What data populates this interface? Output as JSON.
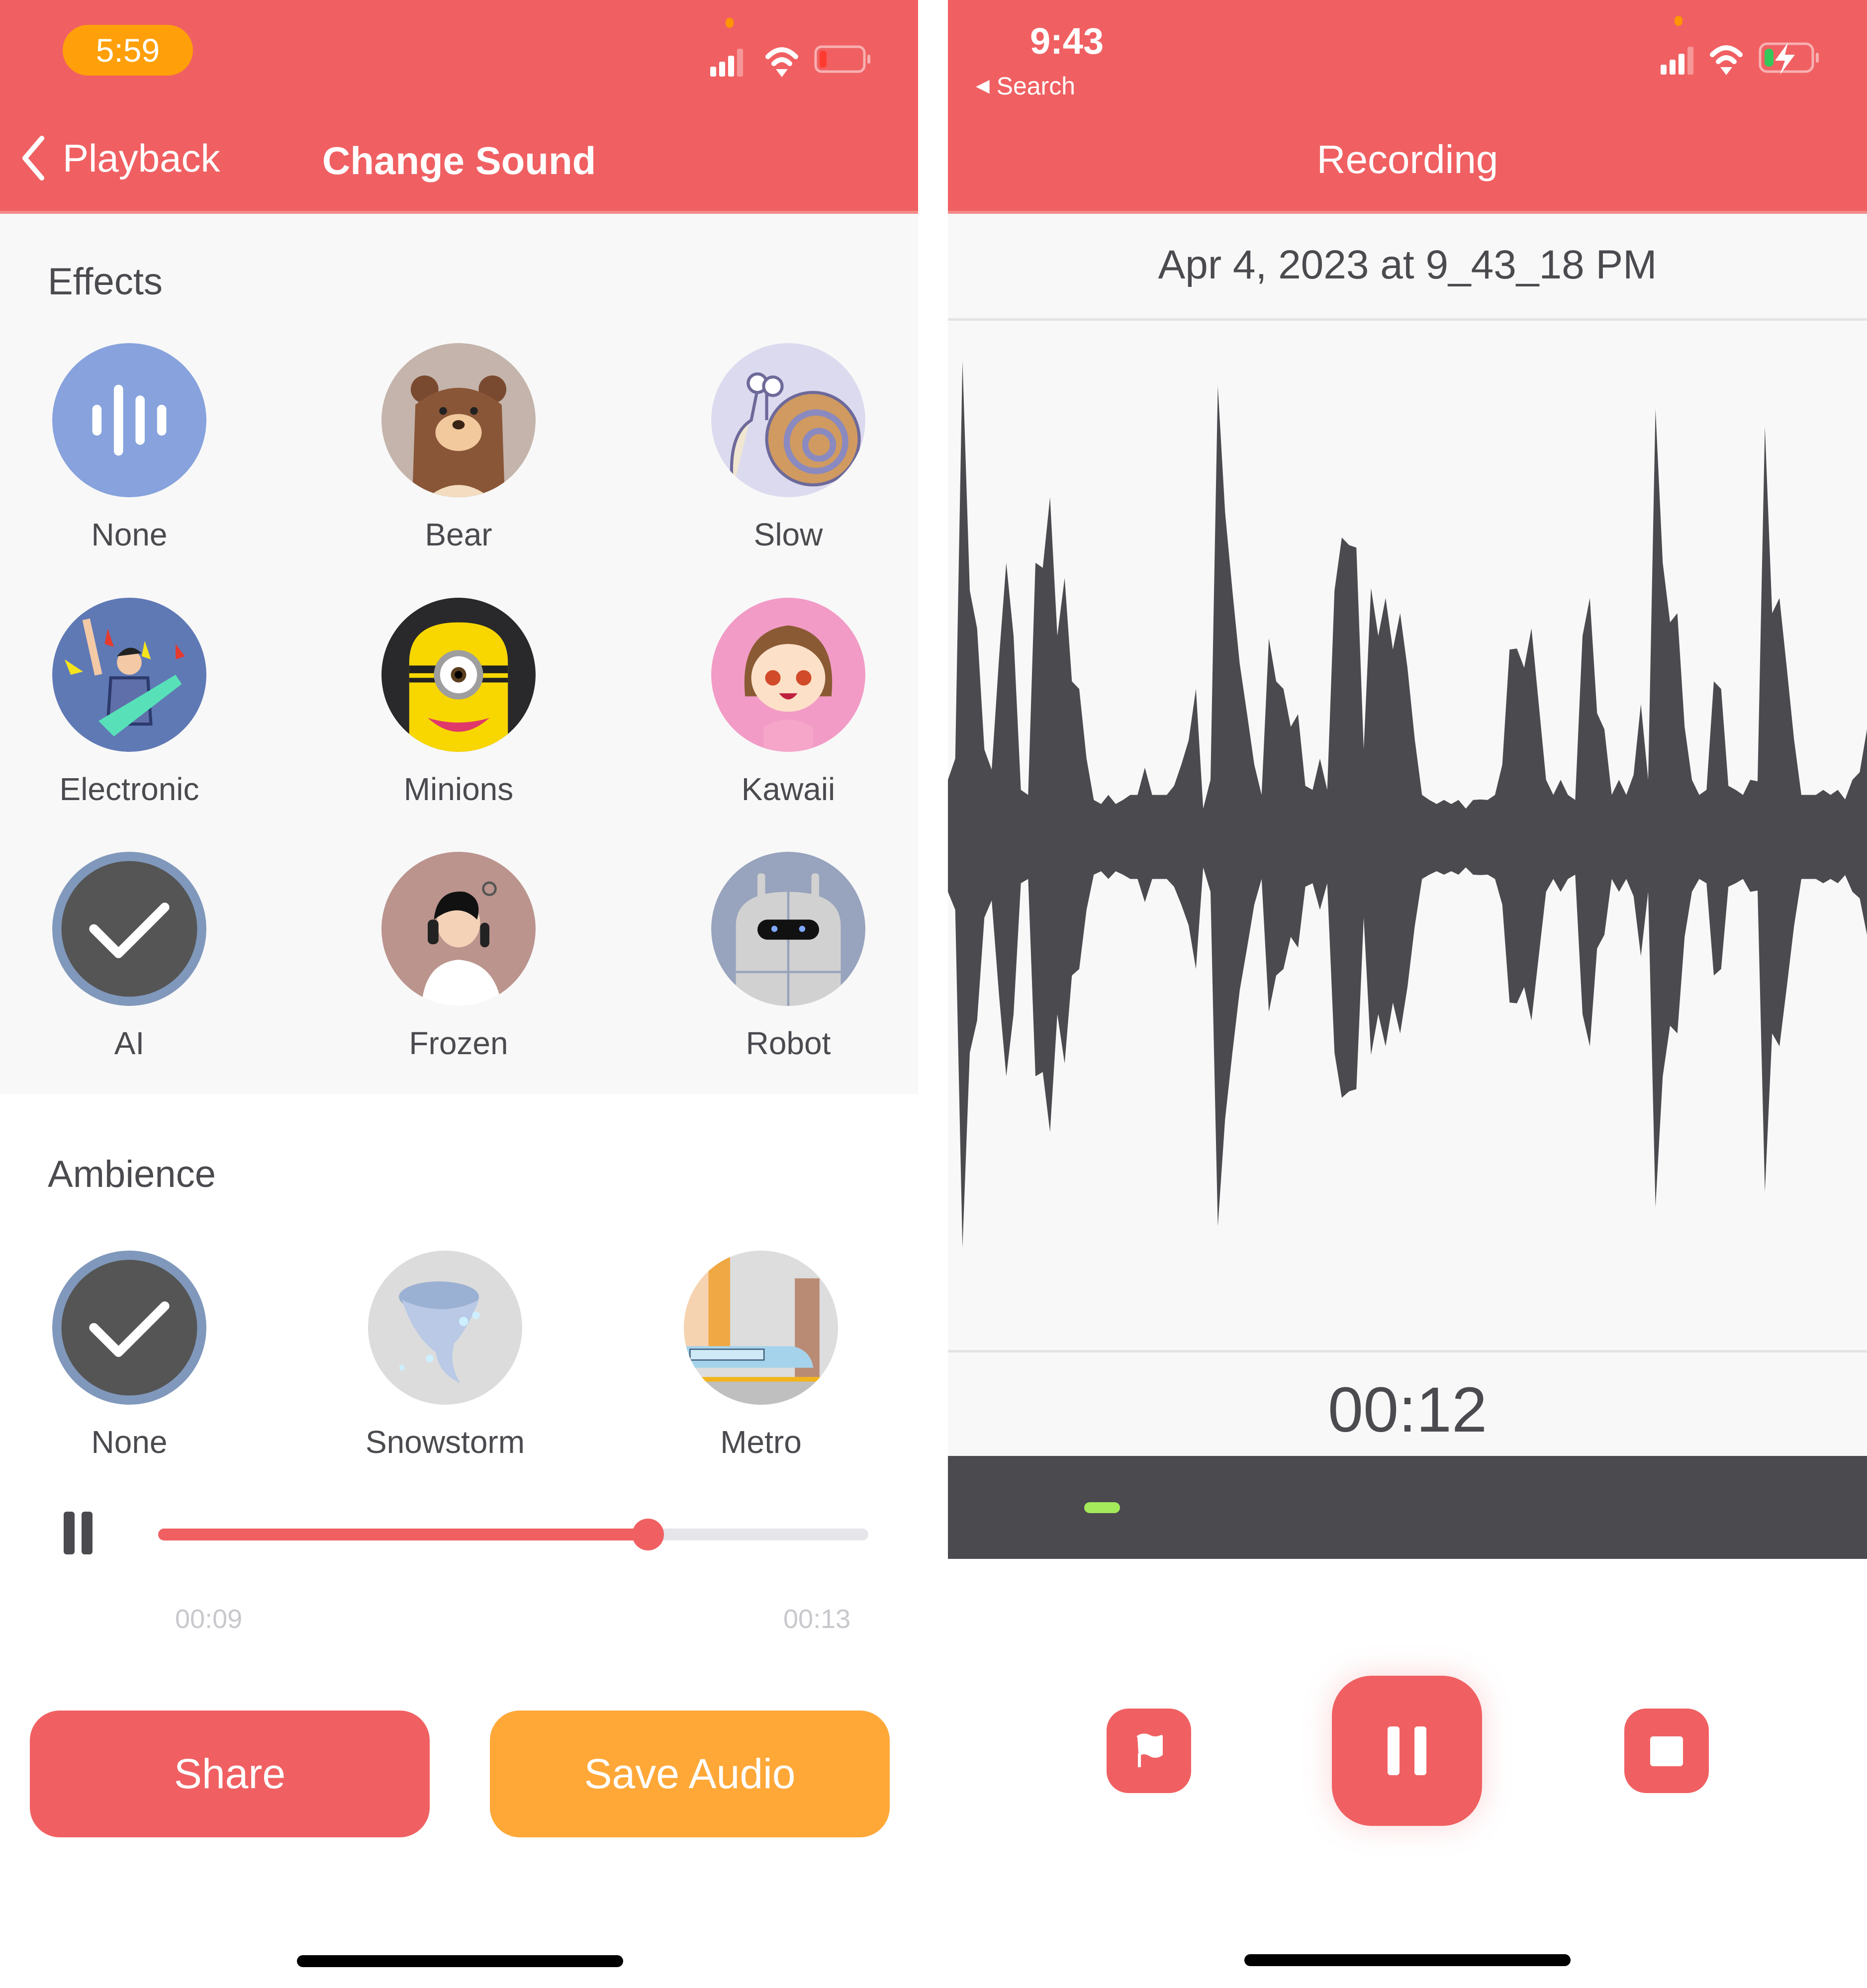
{
  "left_screen": {
    "status_bar": {
      "time": "5:59",
      "battery_level": "low",
      "battery_color": "#ff3b30",
      "pill_color": "#ff9f0a"
    },
    "nav": {
      "back_label": "Playback",
      "title": "Change Sound"
    },
    "effects": {
      "title": "Effects",
      "items": [
        {
          "label": "None",
          "icon": "sound-wave-icon",
          "selected": false
        },
        {
          "label": "Bear",
          "icon": "bear-icon",
          "selected": false
        },
        {
          "label": "Slow",
          "icon": "snail-icon",
          "selected": false
        },
        {
          "label": "Electronic",
          "icon": "rocker-guitar-icon",
          "selected": false
        },
        {
          "label": "Minions",
          "icon": "minion-icon",
          "selected": false
        },
        {
          "label": "Kawaii",
          "icon": "kawaii-girl-icon",
          "selected": false
        },
        {
          "label": "AI",
          "icon": "checkmark-icon",
          "selected": true
        },
        {
          "label": "Frozen",
          "icon": "phone-call-person-icon",
          "selected": false
        },
        {
          "label": "Robot",
          "icon": "robot-icon",
          "selected": false
        }
      ]
    },
    "ambience": {
      "title": "Ambience",
      "items": [
        {
          "label": "None",
          "icon": "checkmark-icon",
          "selected": true
        },
        {
          "label": "Snowstorm",
          "icon": "tornado-snow-icon",
          "selected": false
        },
        {
          "label": "Metro",
          "icon": "metro-train-icon",
          "selected": false
        }
      ]
    },
    "player": {
      "state": "playing",
      "progress": 0.69,
      "current_time": "00:09",
      "total_time": "00:13"
    },
    "buttons": {
      "share": "Share",
      "save": "Save Audio"
    },
    "colors": {
      "accent": "#f06062",
      "save": "#ffa838",
      "text": "#4a4a4f",
      "selected_ring": "#8098bb",
      "selected_fill": "#555555"
    }
  },
  "right_screen": {
    "status_bar": {
      "time": "9:43",
      "back_app": "Search",
      "battery_state": "charging",
      "battery_color": "#34c759"
    },
    "nav": {
      "title": "Recording"
    },
    "recording_name": "Apr 4, 2023 at 9_43_18 PM",
    "timer": "00:12",
    "level_color": "#a4ea5b",
    "controls": {
      "flag": "flag-icon",
      "pause": "pause-icon",
      "stop": "stop-icon"
    },
    "waveform": {
      "description": "audio amplitude envelope, normalized 0-1",
      "envelope": [
        0.12,
        0.18,
        0.95,
        0.55,
        0.42,
        0.2,
        0.14,
        0.4,
        0.55,
        0.45,
        0.1,
        0.1,
        0.55,
        0.6,
        0.68,
        0.45,
        0.52,
        0.35,
        0.3,
        0.18,
        0.08,
        0.08,
        0.09,
        0.08,
        0.08,
        0.1,
        0.09,
        0.16,
        0.09,
        0.1,
        0.09,
        0.12,
        0.15,
        0.22,
        0.3,
        0.07,
        0.12,
        1.0,
        0.65,
        0.55,
        0.35,
        0.28,
        0.15,
        0.1,
        0.4,
        0.35,
        0.3,
        0.25,
        0.25,
        0.12,
        0.1,
        0.18,
        0.1,
        0.55,
        0.6,
        0.65,
        0.58,
        0.2,
        0.5,
        0.45,
        0.48,
        0.42,
        0.45,
        0.38,
        0.2,
        0.1,
        0.08,
        0.08,
        0.08,
        0.08,
        0.08,
        0.07,
        0.08,
        0.09,
        0.08,
        0.1,
        0.15,
        0.42,
        0.38,
        0.38,
        0.42,
        0.3,
        0.12,
        0.1,
        0.12,
        0.1,
        0.08,
        0.45,
        0.48,
        0.28,
        0.22,
        0.1,
        0.12,
        0.1,
        0.13,
        0.3,
        0.12,
        0.95,
        0.55,
        0.48,
        0.45,
        0.25,
        0.12,
        0.1,
        0.1,
        0.35,
        0.3,
        0.12,
        0.1,
        0.1,
        0.12,
        0.13,
        0.82,
        0.5,
        0.48,
        0.38,
        0.2,
        0.1,
        0.09,
        0.1,
        0.1,
        0.1,
        0.1,
        0.09,
        0.12,
        0.15,
        0.22
      ]
    }
  }
}
